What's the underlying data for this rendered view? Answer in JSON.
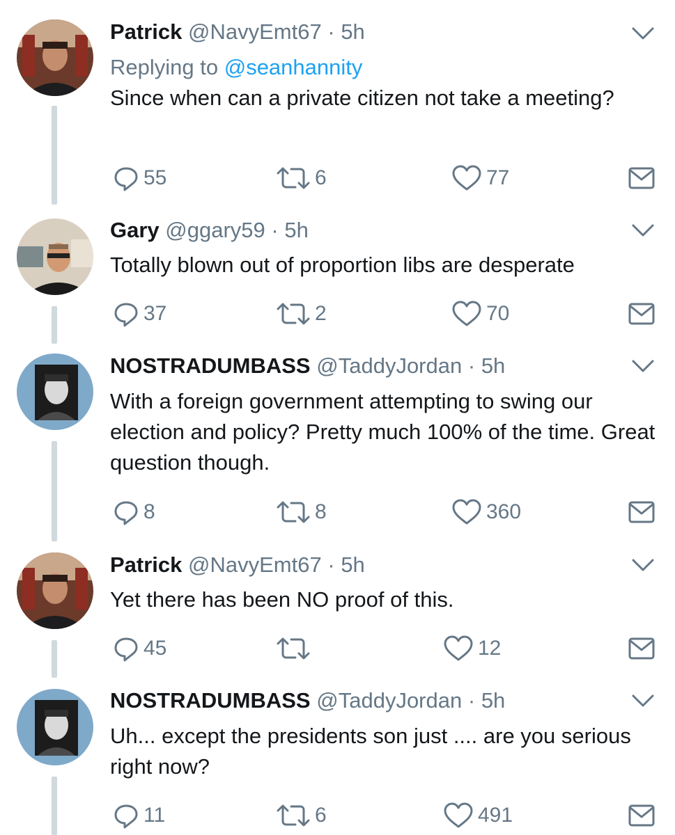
{
  "tweets": [
    {
      "name": "Patrick",
      "handle": "@NavyEmt67",
      "separator": "·",
      "time": "5h",
      "replying_label": "Replying to",
      "replying_mention": "@seanhannity",
      "text": "Since when can a private citizen not take a meeting?",
      "replies": "55",
      "retweets": "6",
      "likes": "77",
      "avatar": "patrick-avatar"
    },
    {
      "name": "Gary",
      "handle": "@ggary59",
      "separator": "·",
      "time": "5h",
      "text": "Totally blown out of proportion libs are desperate",
      "replies": "37",
      "retweets": "2",
      "likes": "70",
      "avatar": "gary-avatar"
    },
    {
      "name": "NOSTRADUMBASS",
      "handle": "@TaddyJordan",
      "separator": "·",
      "time": "5h",
      "text": "With a foreign government attempting to swing our election and policy? Pretty much 100% of the time. Great question though.",
      "replies": "8",
      "retweets": "8",
      "likes": "360",
      "avatar": "nostradumbass-avatar"
    },
    {
      "name": "Patrick",
      "handle": "@NavyEmt67",
      "separator": "·",
      "time": "5h",
      "text": "Yet there has been NO proof of this.",
      "replies": "45",
      "retweets": "",
      "likes": "12",
      "avatar": "patrick-avatar"
    },
    {
      "name": "NOSTRADUMBASS",
      "handle": "@TaddyJordan",
      "separator": "·",
      "time": "5h",
      "text": "Uh... except the presidents son just .... are you serious right now?",
      "replies": "11",
      "retweets": "6",
      "likes": "491",
      "avatar": "nostradumbass-avatar"
    }
  ],
  "icons": {
    "reply": "reply-icon",
    "retweet": "retweet-icon",
    "like": "heart-icon",
    "dm": "envelope-icon",
    "caret": "chevron-down-icon"
  },
  "colors": {
    "text": "#14171a",
    "secondary": "#657786",
    "link": "#1da1f2",
    "thread_line": "#cfd9de"
  }
}
